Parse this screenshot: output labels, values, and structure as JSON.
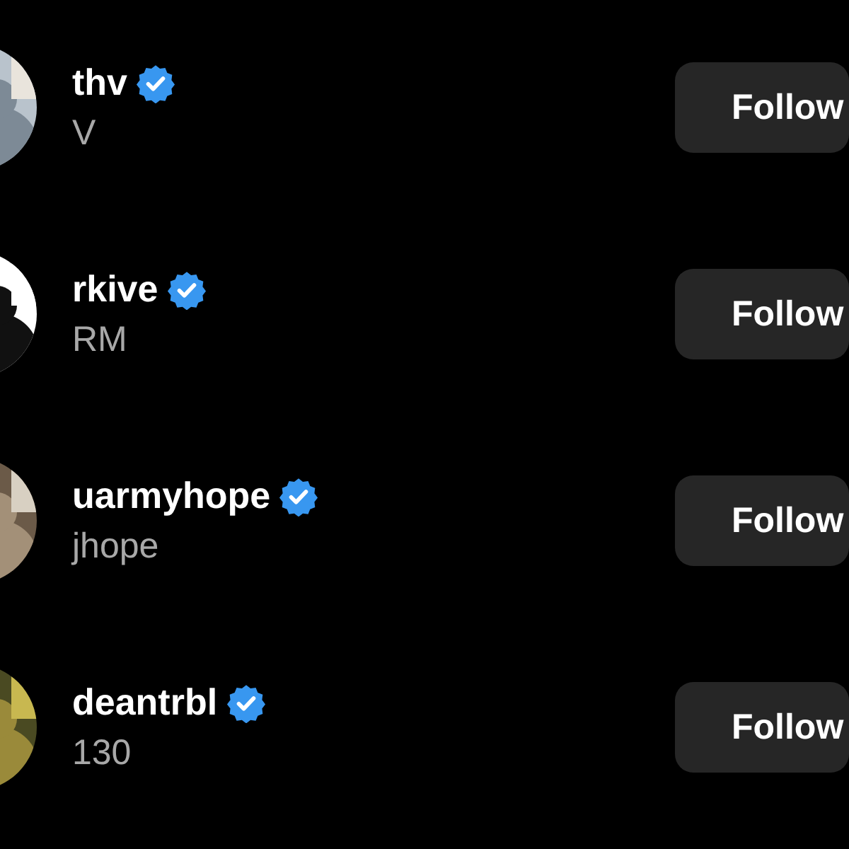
{
  "accounts": [
    {
      "username": "thv",
      "display_name": "V",
      "verified": true,
      "button": "Follow"
    },
    {
      "username": "rkive",
      "display_name": "RM",
      "verified": true,
      "button": "Follow"
    },
    {
      "username": "uarmyhope",
      "display_name": "jhope",
      "verified": true,
      "button": "Follow"
    },
    {
      "username": "deantrbl",
      "display_name": "130",
      "verified": true,
      "button": "Follow"
    }
  ]
}
